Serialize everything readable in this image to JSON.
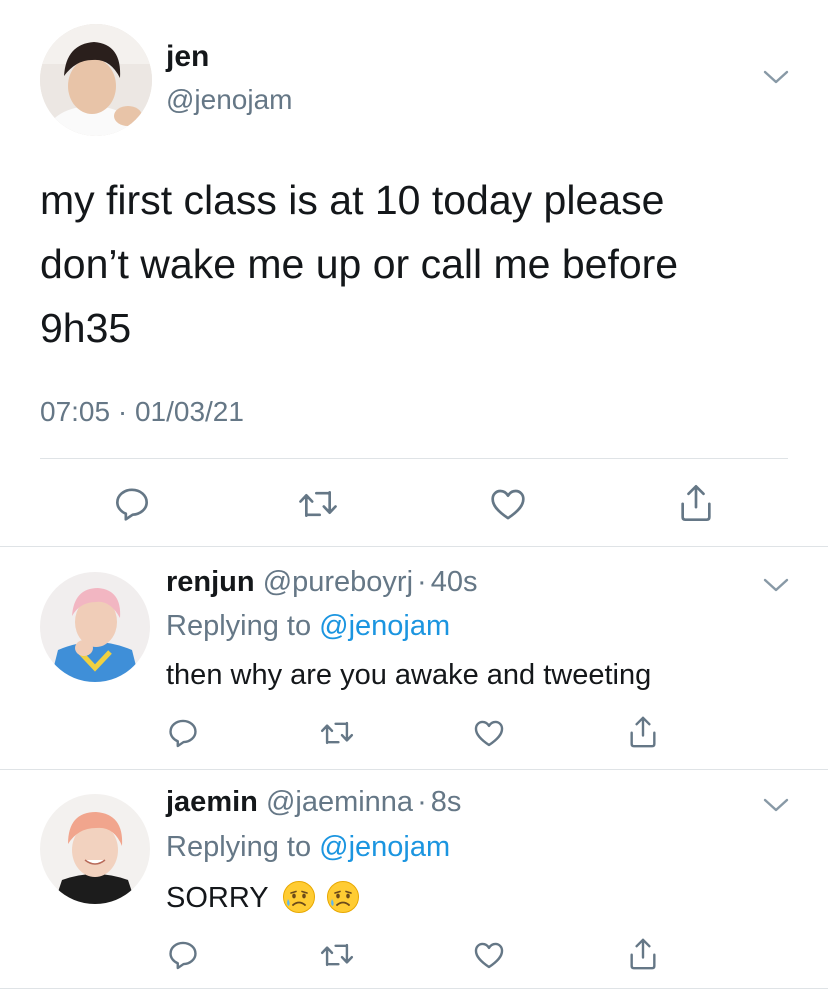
{
  "main_tweet": {
    "display_name": "jen",
    "handle": "@jenojam",
    "text": "my first class is at 10 today please don’t wake me up or call me before 9h35",
    "timestamp": "07:05 · 01/03/21"
  },
  "replies": [
    {
      "display_name": "renjun",
      "handle": "@pureboyrj",
      "sep": "·",
      "time": "40s",
      "replying_label": "Replying to",
      "replying_to": "@jenojam",
      "text": "then why are you awake and tweeting"
    },
    {
      "display_name": "jaemin",
      "handle": "@jaeminna",
      "sep": "·",
      "time": "8s",
      "replying_label": "Replying to",
      "replying_to": "@jenojam",
      "text": "SORRY",
      "emoji": [
        "sad-sweat-emoji",
        "sad-sweat-emoji"
      ]
    }
  ],
  "colors": {
    "text": "#14171a",
    "muted": "#657786",
    "link": "#1b95e0",
    "divider": "#dfe3e6"
  },
  "icons": [
    "reply-icon",
    "retweet-icon",
    "like-icon",
    "share-icon",
    "chevron-down-icon"
  ]
}
